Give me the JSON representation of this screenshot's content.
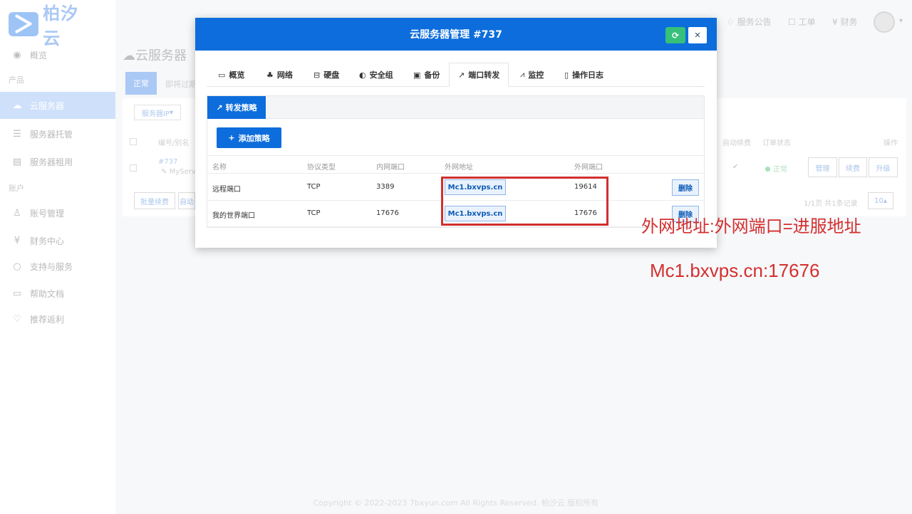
{
  "brand": {
    "name": "柏汐云"
  },
  "sidebar": {
    "items_top": [
      {
        "label": "概览",
        "icon": "dashboard-icon"
      }
    ],
    "section_products": "产品",
    "products": [
      {
        "label": "云服务器",
        "icon": "cloud-server-icon"
      },
      {
        "label": "服务器托管",
        "icon": "server-hosting-icon"
      },
      {
        "label": "服务器租用",
        "icon": "server-rental-icon"
      }
    ],
    "section_account": "账户",
    "account": [
      {
        "label": "账号管理",
        "icon": "user-icon"
      },
      {
        "label": "财务中心",
        "icon": "yen-icon"
      },
      {
        "label": "支持与服务",
        "icon": "chat-icon"
      },
      {
        "label": "帮助文档",
        "icon": "doc-icon"
      },
      {
        "label": "推荐返利",
        "icon": "heart-icon"
      }
    ]
  },
  "header": {
    "notice": "服务公告",
    "ticket": "工单",
    "finance": "财务"
  },
  "background": {
    "title": "云服务器",
    "tab_active": "正常",
    "tab_other": "即将过期",
    "filter": "服务器IP",
    "col_id": "编号/别名",
    "col_autorenew": "自动续费",
    "col_status": "订单状态",
    "col_action": "操作",
    "row_id": "#737",
    "row_alias": "MyServ",
    "row_status": "正常",
    "btn_manage": "管理",
    "btn_renew": "续费",
    "btn_upgrade": "升级",
    "btn_batch_renew": "批量续费",
    "btn_auto": "自动",
    "pagination": "1/1页 共1条记录",
    "page_size": "10"
  },
  "modal": {
    "title": "云服务器管理 #737",
    "tabs": [
      {
        "label": "概览",
        "icon": "monitor-icon"
      },
      {
        "label": "网络",
        "icon": "network-icon"
      },
      {
        "label": "硬盘",
        "icon": "disk-icon"
      },
      {
        "label": "安全组",
        "icon": "shield-icon"
      },
      {
        "label": "备份",
        "icon": "save-icon"
      },
      {
        "label": "端口转发",
        "icon": "external-link-icon"
      },
      {
        "label": "监控",
        "icon": "pulse-icon"
      },
      {
        "label": "操作日志",
        "icon": "file-icon"
      }
    ],
    "active_tab": "端口转发",
    "panel_tab": "转发策略",
    "add_button": "添加策略",
    "columns": [
      "名称",
      "协议类型",
      "内网端口",
      "外网地址",
      "外网端口"
    ],
    "rows": [
      {
        "name": "远程端口",
        "protocol": "TCP",
        "internal_port": "3389",
        "address": "Mc1.bxvps.cn",
        "external_port": "19614",
        "delete": "删除"
      },
      {
        "name": "我的世界端口",
        "protocol": "TCP",
        "internal_port": "17676",
        "address": "Mc1.bxvps.cn",
        "external_port": "17676",
        "delete": "删除"
      }
    ]
  },
  "annotation": {
    "formula": "外网地址:外网端口=进服地址",
    "example": "Mc1.bxvps.cn:17676",
    "color": "#d32f2f"
  },
  "footer": "Copyright © 2022-2023 7bxyun.com All Rights Reserved. 柏汐云 版权所有"
}
